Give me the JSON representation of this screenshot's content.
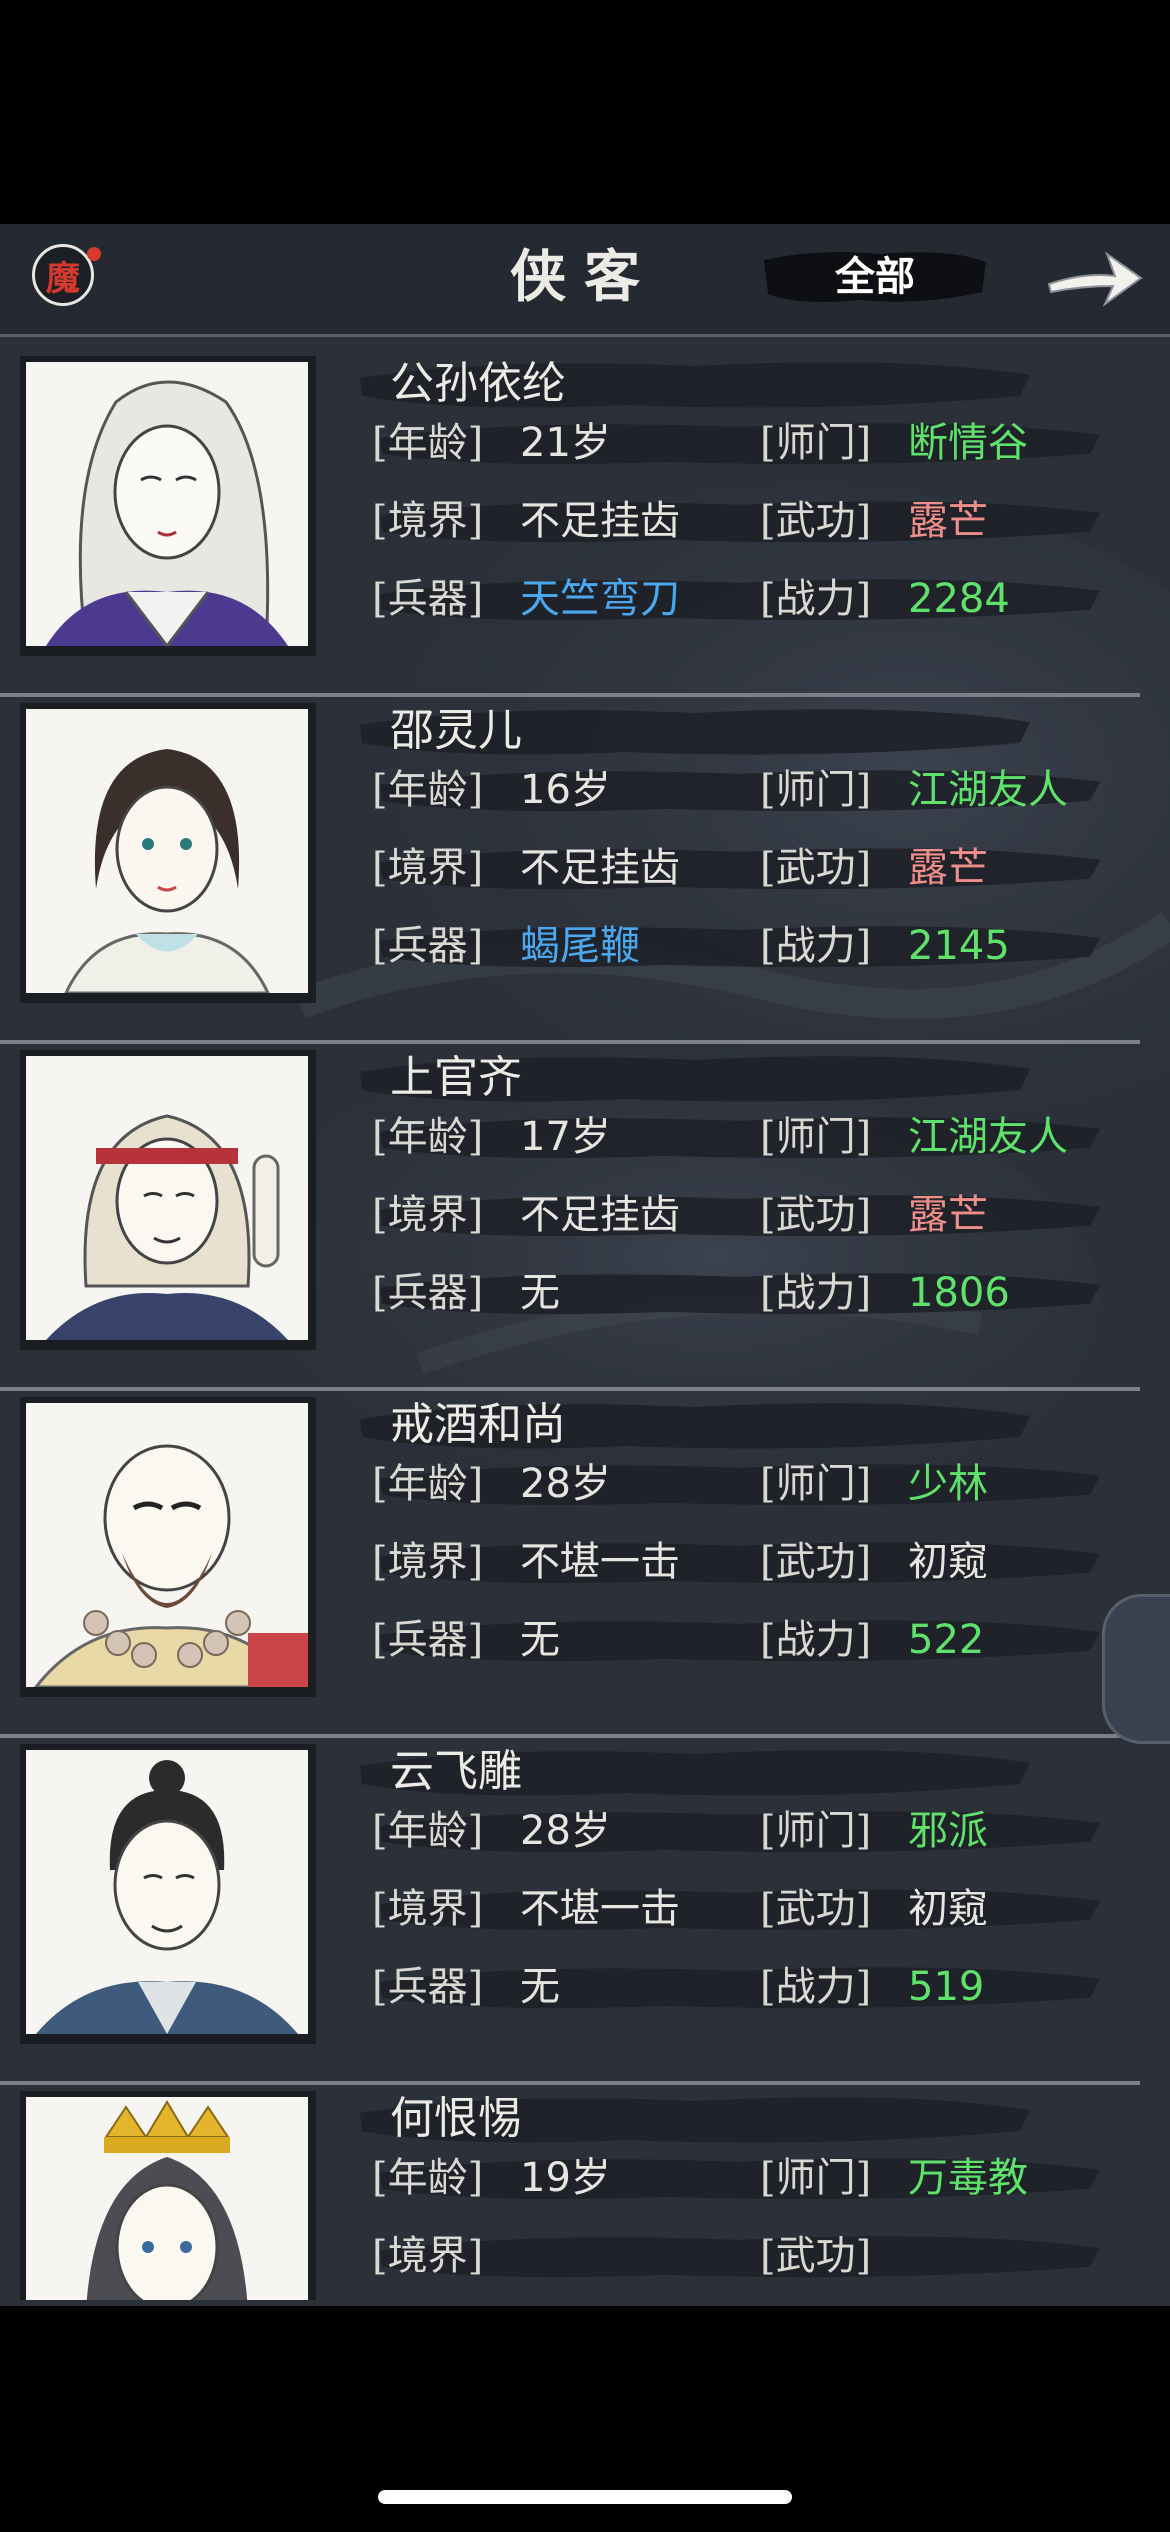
{
  "header": {
    "logo_text": "魔",
    "title": "侠客",
    "filter_label": "全部"
  },
  "labels": {
    "age": "[年龄]",
    "sect": "[师门]",
    "realm": "[境界]",
    "kungfu": "[武功]",
    "weapon": "[兵器]",
    "power": "[战力]"
  },
  "heroes": [
    {
      "name": "公孙依纶",
      "age": "21岁",
      "sect": "断情谷",
      "realm": "不足挂齿",
      "kungfu": "露芒",
      "weapon": "天竺弯刀",
      "power": "2284",
      "colors": {
        "sect": "green",
        "kungfu": "pink",
        "weapon": "blue",
        "power": "green"
      }
    },
    {
      "name": "邵灵儿",
      "age": "16岁",
      "sect": "江湖友人",
      "realm": "不足挂齿",
      "kungfu": "露芒",
      "weapon": "蝎尾鞭",
      "power": "2145",
      "colors": {
        "sect": "green",
        "kungfu": "pink",
        "weapon": "blue",
        "power": "green"
      }
    },
    {
      "name": "上官齐",
      "age": "17岁",
      "sect": "江湖友人",
      "realm": "不足挂齿",
      "kungfu": "露芒",
      "weapon": "无",
      "power": "1806",
      "colors": {
        "sect": "green",
        "kungfu": "pink",
        "weapon": "white",
        "power": "green"
      }
    },
    {
      "name": "戒酒和尚",
      "age": "28岁",
      "sect": "少林",
      "realm": "不堪一击",
      "kungfu": "初窥",
      "weapon": "无",
      "power": "522",
      "colors": {
        "sect": "green",
        "kungfu": "white",
        "weapon": "white",
        "power": "green"
      }
    },
    {
      "name": "云飞雕",
      "age": "28岁",
      "sect": "邪派",
      "realm": "不堪一击",
      "kungfu": "初窥",
      "weapon": "无",
      "power": "519",
      "colors": {
        "sect": "green",
        "kungfu": "white",
        "weapon": "white",
        "power": "green"
      }
    },
    {
      "name": "何恨惕",
      "age": "19岁",
      "sect": "万毒教",
      "realm": "",
      "kungfu": "",
      "weapon": "",
      "power": "",
      "colors": {
        "sect": "green",
        "kungfu": "white",
        "weapon": "white",
        "power": "green"
      }
    }
  ],
  "colors": {
    "white": "#e6e5e0",
    "green": "#5fe26b",
    "pink": "#f08f8a",
    "blue": "#4ba8ee",
    "panel": "#2b3039",
    "header": "#252931"
  },
  "icons": {
    "logo": "demon-seal-icon",
    "next": "arrow-right-icon",
    "side_tab": "side-drawer-icon"
  }
}
